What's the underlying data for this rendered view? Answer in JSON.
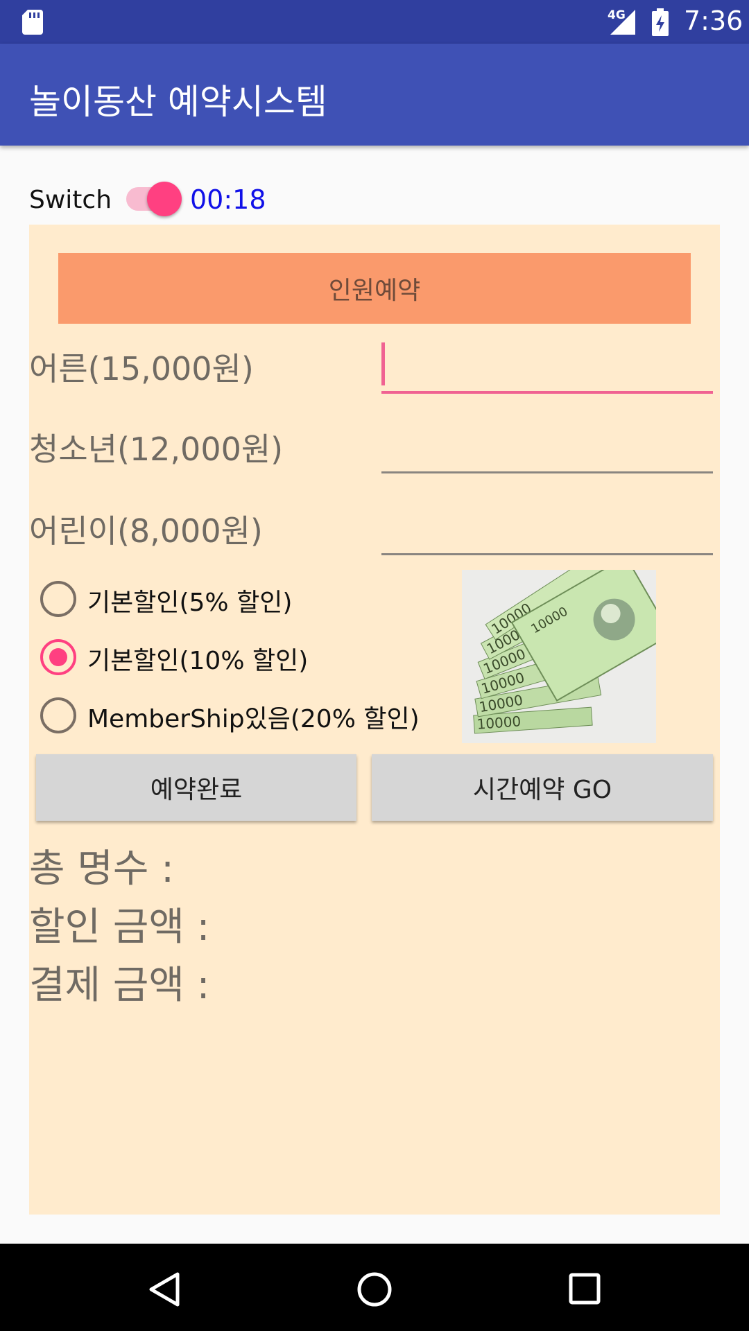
{
  "status_bar": {
    "time": "7:36",
    "network": "4G",
    "icons": [
      "sd-card-icon",
      "signal-icon",
      "battery-charging-icon"
    ]
  },
  "app_bar": {
    "title": "놀이동산 예약시스템"
  },
  "switch": {
    "label": "Switch",
    "on": true,
    "timer": "00:18"
  },
  "reservation": {
    "header_button": "인원예약",
    "fields": [
      {
        "label": "어른(15,000원)",
        "value": ""
      },
      {
        "label": "청소년(12,000원)",
        "value": ""
      },
      {
        "label": "어린이(8,000원)",
        "value": ""
      }
    ],
    "discount_options": [
      {
        "label": "기본할인(5% 할인)",
        "checked": false
      },
      {
        "label": "기본할인(10% 할인)",
        "checked": true
      },
      {
        "label": "MemberShip있음(20% 할인)",
        "checked": false
      }
    ],
    "image": {
      "icon": "money-banknotes-image",
      "note_text": "10000"
    },
    "buttons": {
      "complete": "예약완료",
      "time_reservation": "시간예약 GO"
    }
  },
  "summary": {
    "total_people": "총 명수 :",
    "discount_amount": "할인 금액 :",
    "payment_amount": "결제 금액 :"
  },
  "colors": {
    "status_bar": "#303F9F",
    "app_bar": "#3F51B5",
    "accent": "#FF4081",
    "panel_background": "#FFEBCD",
    "header_button": "#FA9A6C",
    "timer_text": "#1010E8"
  },
  "nav_bar": {
    "icons": [
      "back-icon",
      "home-icon",
      "recents-icon"
    ]
  }
}
